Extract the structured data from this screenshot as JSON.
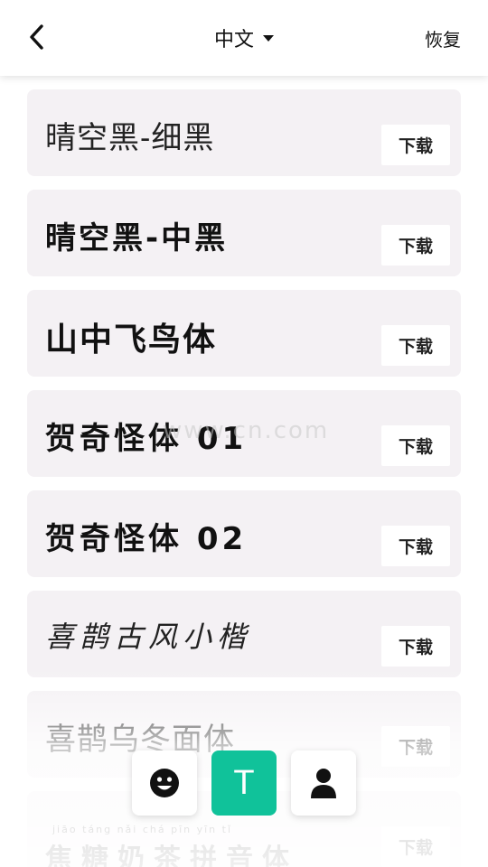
{
  "header": {
    "language": "中文",
    "restore_label": "恢复"
  },
  "fonts": [
    {
      "name": "晴空黑-细黑",
      "action": "下载"
    },
    {
      "name": "晴空黑-中黑",
      "action": "下载"
    },
    {
      "name": "山中飞鸟体",
      "action": "下载"
    },
    {
      "name": "贺奇怪体 01",
      "action": "下载"
    },
    {
      "name": "贺奇怪体 02",
      "action": "下载"
    },
    {
      "name": "喜鹊古风小楷",
      "action": "下载"
    },
    {
      "name": "喜鹊乌冬面体",
      "action": "下载"
    },
    {
      "name": "焦糖奶茶拼音体",
      "pinyin": "jiāo  táng  nǎi  chá  pīn  yīn  tǐ",
      "action": "下载"
    }
  ],
  "watermark": "www.cn.com",
  "bottom_nav": {
    "items": [
      {
        "icon": "smiley-icon"
      },
      {
        "icon": "text-icon",
        "glyph": "T",
        "active": true
      },
      {
        "icon": "user-icon"
      }
    ],
    "active_color": "#10c29a"
  }
}
